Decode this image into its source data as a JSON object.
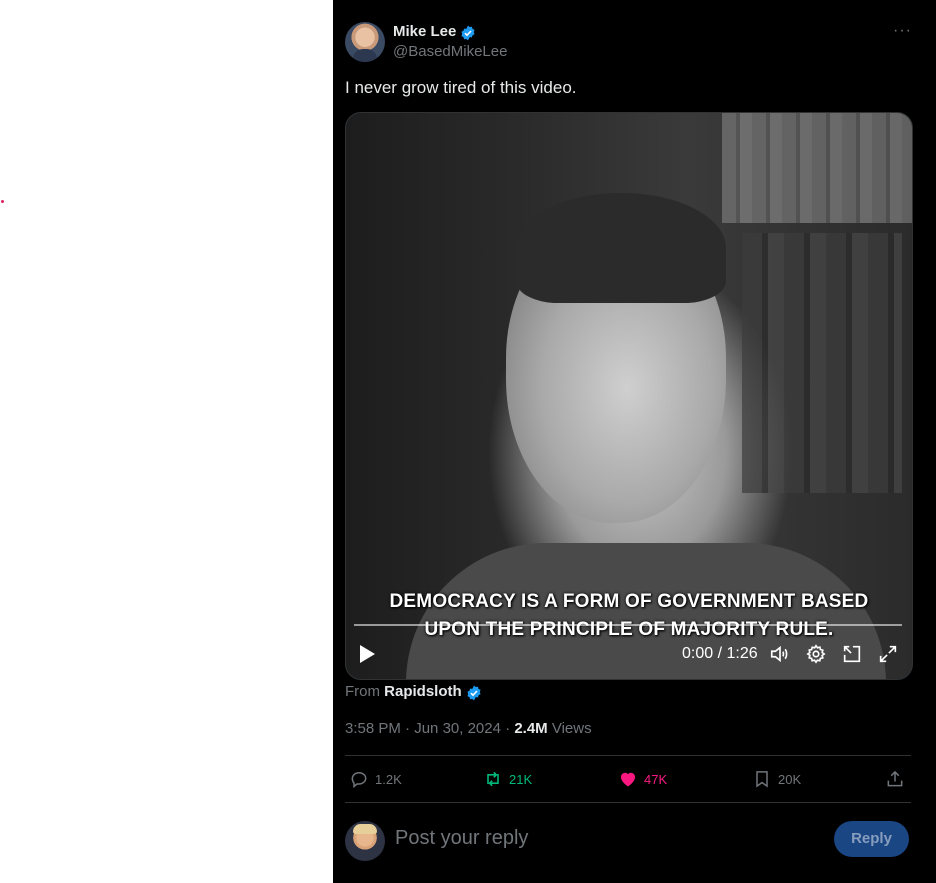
{
  "tweet": {
    "author_name": "Mike Lee",
    "author_handle": "@BasedMikeLee",
    "text": "I never grow tired of this video.",
    "more_label": "···"
  },
  "video": {
    "caption_line1": "DEMOCRACY IS A FORM OF GOVERNMENT BASED",
    "caption_line2": "UPON THE PRINCIPLE OF MAJORITY RULE.",
    "time": "0:00 / 1:26",
    "progress": 0
  },
  "source": {
    "from_label": "From",
    "from_name": "Rapidsloth"
  },
  "meta": {
    "time": "3:58 PM",
    "date": "Jun 30, 2024",
    "separator": " · ",
    "views_count": "2.4M",
    "views_label": "Views"
  },
  "actions": {
    "replies": "1.2K",
    "reposts": "21K",
    "likes": "47K",
    "bookmarks": "20K"
  },
  "reply_box": {
    "placeholder": "Post your reply",
    "button_label": "Reply"
  },
  "colors": {
    "background": "#000000",
    "verified": "#1d9bf0",
    "repost_green": "#00ba7c",
    "like_pink": "#f91880",
    "muted": "#71767b"
  }
}
